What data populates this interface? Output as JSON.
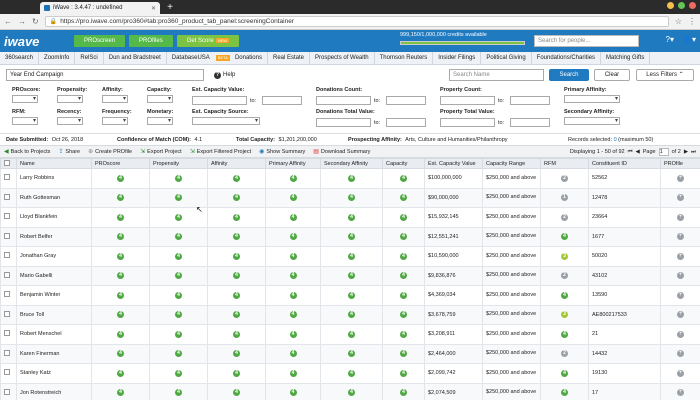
{
  "browser": {
    "tab_title": "iWave : 3.4.47 : undefined",
    "url": "https://pro.iwave.com/pro360#tab:pro360_product_tab_panel:screeningContainer"
  },
  "header": {
    "logo": "iwave",
    "buttons": [
      "PROscreen",
      "PROfiles",
      "Get Score"
    ],
    "new_tag": "NEW",
    "credits": "999,150/1,000,000 credits available",
    "credits_fraction": 0.99915,
    "search_placeholder": "Search for people..."
  },
  "nav_tabs": [
    "360search",
    "ZoomInfo",
    "RelSci",
    "Dun and Bradstreet",
    "DatabaseUSA",
    "Donations",
    "Real Estate",
    "Prospects of Wealth",
    "Thomson Reuters",
    "Insider Filings",
    "Political Giving",
    "Foundations/Charities",
    "Matching Gifts"
  ],
  "beta_tag": "BETA",
  "campaign": {
    "value": "Year End Campaign",
    "help": "Help",
    "search_name_placeholder": "Search Name",
    "search_btn": "Search",
    "clear_btn": "Clear",
    "less_filters_btn": "Less Filters"
  },
  "filters": {
    "proscore": "PROscore:",
    "propensity": "Propensity:",
    "affinity": "Affinity:",
    "capacity": "Capacity:",
    "est_capacity_value": "Est. Capacity Value:",
    "donations_count": "Donations Count:",
    "property_count": "Property Count:",
    "primary_affinity": "Primary Affinity:",
    "rfm": "RFM:",
    "recency": "Recency:",
    "frequency": "Frequency:",
    "monetary": "Monetary:",
    "est_capacity_source": "Est. Capacity Source:",
    "donations_total_value": "Donations Total Value:",
    "property_total_value": "Property Total Value:",
    "secondary_affinity": "Secondary Affinity:",
    "to": "to:"
  },
  "summary": {
    "date_label": "Date Submitted:",
    "date": "Oct 26, 2018",
    "com_label": "Confidence of Match (COM):",
    "com": "4.1",
    "cap_label": "Total Capacity:",
    "cap": "$1,201,200,000",
    "aff_label": "Prospecting Affinity:",
    "aff": "Arts, Culture and Humanities/Philanthropy",
    "records_label": "Records selected:",
    "records": "0",
    "records_max": "(maximum 50)"
  },
  "toolbar": {
    "back": "Back to Projects",
    "share": "Share",
    "create": "Create PROfile",
    "export": "Export Project",
    "export_filtered": "Export Filtered Project",
    "show_summary": "Show Summary",
    "download_summary": "Download Summary",
    "displaying": "Displaying 1 - 50 of 92",
    "page_label": "Page",
    "page": "1",
    "of": "of 2"
  },
  "columns": [
    "Name",
    "PROscore",
    "Propensity",
    "Affinity",
    "Primary Affinity",
    "Secondary Affinity",
    "Capacity",
    "Est. Capacity Value",
    "Capacity Range",
    "RFM",
    "Constituent ID",
    "PROfile"
  ],
  "rows": [
    {
      "name": "Larry Robbins",
      "vals": [
        "4",
        "4",
        "4",
        "4",
        "4",
        "4"
      ],
      "est": "$100,000,000",
      "range": "$250,000 and above",
      "rfm": "2",
      "rfm_c": "g",
      "id": "52562"
    },
    {
      "name": "Ruth Gottesman",
      "vals": [
        "4",
        "4",
        "4",
        "4",
        "4",
        "4"
      ],
      "est": "$90,000,000",
      "range": "$250,000 and above",
      "rfm": "1",
      "rfm_c": "g",
      "id": "12478"
    },
    {
      "name": "Lloyd Blankfein",
      "vals": [
        "4",
        "4",
        "4",
        "4",
        "4",
        "4"
      ],
      "est": "$15,932,145",
      "range": "$250,000 and above",
      "rfm": "2",
      "rfm_c": "g",
      "id": "23664"
    },
    {
      "name": "Robert Belfer",
      "vals": [
        "4",
        "4",
        "4",
        "4",
        "4",
        "4"
      ],
      "est": "$12,551,241",
      "range": "$250,000 and above",
      "rfm": "4",
      "rfm_c": "",
      "id": "1677"
    },
    {
      "name": "Jonathan Gray",
      "vals": [
        "4",
        "4",
        "4",
        "4",
        "4",
        "4"
      ],
      "est": "$10,590,000",
      "range": "$250,000 and above",
      "rfm": "3",
      "rfm_c": "y",
      "id": "50020"
    },
    {
      "name": "Mario Gabelli",
      "vals": [
        "4",
        "4",
        "4",
        "4",
        "4",
        "4"
      ],
      "est": "$9,836,876",
      "range": "$250,000 and above",
      "rfm": "2",
      "rfm_c": "g",
      "id": "43102"
    },
    {
      "name": "Benjamin Winter",
      "vals": [
        "4",
        "4",
        "4",
        "4",
        "4",
        "4"
      ],
      "est": "$4,369,034",
      "range": "$250,000 and above",
      "rfm": "4",
      "rfm_c": "",
      "id": "13590"
    },
    {
      "name": "Bruce Toll",
      "vals": [
        "4",
        "4",
        "4",
        "4",
        "4",
        "4"
      ],
      "est": "$3,678,759",
      "range": "$250,000 and above",
      "rfm": "3",
      "rfm_c": "y",
      "id": "AE800217533"
    },
    {
      "name": "Robert Menschel",
      "vals": [
        "4",
        "4",
        "4",
        "4",
        "4",
        "4"
      ],
      "est": "$3,208,911",
      "range": "$250,000 and above",
      "rfm": "4",
      "rfm_c": "",
      "id": "21"
    },
    {
      "name": "Karen Finerman",
      "vals": [
        "4",
        "4",
        "4",
        "4",
        "4",
        "4"
      ],
      "est": "$2,464,000",
      "range": "$250,000 and above",
      "rfm": "2",
      "rfm_c": "g",
      "id": "14432"
    },
    {
      "name": "Stanley Katz",
      "vals": [
        "4",
        "4",
        "4",
        "4",
        "4",
        "4"
      ],
      "est": "$2,099,742",
      "range": "$250,000 and above",
      "rfm": "4",
      "rfm_c": "",
      "id": "19130"
    },
    {
      "name": "Jon Rotenstreich",
      "vals": [
        "4",
        "4",
        "4",
        "4",
        "4",
        "4"
      ],
      "est": "$2,074,509",
      "range": "$250,000 and above",
      "rfm": "4",
      "rfm_c": "",
      "id": "17"
    }
  ]
}
